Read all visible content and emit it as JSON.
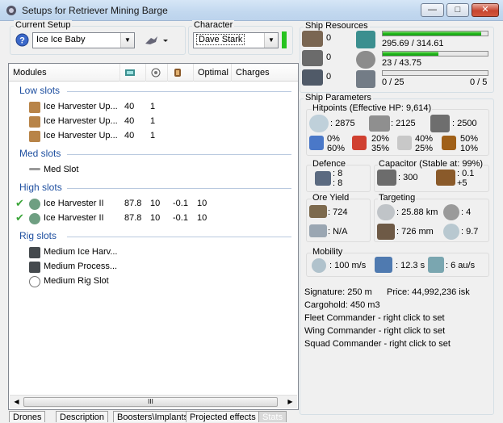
{
  "window": {
    "title": "Setups for Retriever Mining Barge",
    "buttons": {
      "minimize": "—",
      "maximize": "□",
      "close": "✕"
    }
  },
  "current_setup": {
    "label": "Current Setup",
    "value": "Ice Ice Baby"
  },
  "character": {
    "label": "Character",
    "value": "Dave Stark"
  },
  "modules_table": {
    "headers": [
      "Modules",
      "Optimal",
      "Charges"
    ],
    "sections": {
      "low": {
        "title": "Low slots",
        "rows": [
          {
            "name": "Ice Harvester Up...",
            "c1": "40",
            "c2": "1"
          },
          {
            "name": "Ice Harvester Up...",
            "c1": "40",
            "c2": "1"
          },
          {
            "name": "Ice Harvester Up...",
            "c1": "40",
            "c2": "1"
          }
        ]
      },
      "med": {
        "title": "Med slots",
        "rows": [
          {
            "name": "Med Slot"
          }
        ]
      },
      "high": {
        "title": "High slots",
        "rows": [
          {
            "name": "Ice Harvester II",
            "c1": "87.8",
            "c2": "10",
            "c3": "-0.1",
            "c4": "10"
          },
          {
            "name": "Ice Harvester II",
            "c1": "87.8",
            "c2": "10",
            "c3": "-0.1",
            "c4": "10"
          }
        ]
      },
      "rig": {
        "title": "Rig slots",
        "rows": [
          {
            "name": "Medium Ice Harv..."
          },
          {
            "name": "Medium Process..."
          },
          {
            "name": "Medium Rig Slot"
          }
        ]
      }
    }
  },
  "scroll": {
    "grip": "III"
  },
  "tabs": [
    "Drones",
    "Description",
    "Boosters\\Implants",
    "Projected effects",
    "Stats"
  ],
  "ship_resources": {
    "title": "Ship Resources",
    "turret": "0",
    "launcher": "0",
    "drone_bay": "0",
    "cpu": {
      "text": "295.69 / 314.61",
      "fraction": 0.94
    },
    "powergrid": {
      "text": "23 / 43.75",
      "fraction": 0.53
    },
    "drone_bandwidth": {
      "text": "0 / 25",
      "count": "0 / 5",
      "fraction": 0
    }
  },
  "ship_parameters": {
    "title": "Ship Parameters",
    "hitpoints": {
      "label": "Hitpoints (Effective HP: 9,614)",
      "shield": ": 2875",
      "armor": ": 2125",
      "structure": ": 2500"
    },
    "resists": {
      "em": {
        "a": "0%",
        "b": "60%"
      },
      "thermal": {
        "a": "20%",
        "b": "35%"
      },
      "kinetic": {
        "a": "40%",
        "b": "25%"
      },
      "explosive": {
        "a": "50%",
        "b": "10%"
      }
    },
    "defence": {
      "label": "Defence",
      "v1": ": 8",
      "v2": ": 8"
    },
    "capacitor": {
      "label": "Capacitor (Stable at: 99%)",
      "amount": ": 300",
      "delta_a": ": 0.1",
      "delta_b": "+5"
    },
    "ore_yield": {
      "label": "Ore Yield",
      "v1": ": 724",
      "v2": ": N/A"
    },
    "targeting": {
      "label": "Targeting",
      "range": ": 25.88 km",
      "targets": ": 4",
      "res": ": 726 mm",
      "scan": ": 9.7"
    },
    "mobility": {
      "label": "Mobility",
      "speed": ": 100 m/s",
      "align": ": 12.3 s",
      "warp": ": 6 au/s"
    },
    "signature": "Signature: 250 m",
    "price": "Price: 44,992,236 isk",
    "cargohold": "Cargohold: 450 m3",
    "fleet": "Fleet Commander - right click to set",
    "wing": "Wing Commander - right click to set",
    "squad": "Squad Commander - right click to set"
  }
}
